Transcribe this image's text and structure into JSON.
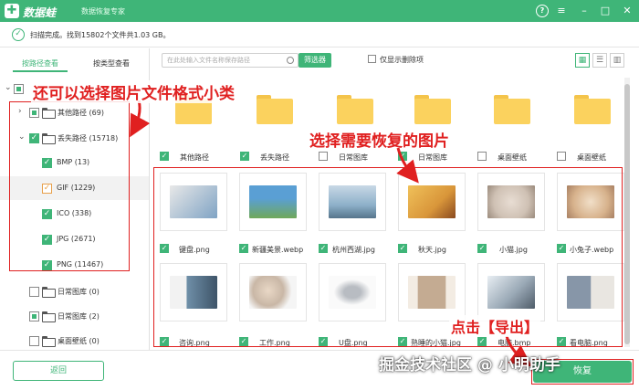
{
  "app": {
    "name": "数据蛙",
    "subtitle": "数据恢复专家"
  },
  "status": {
    "text": "扫描完成。找到15802个文件共1.03 GB。"
  },
  "left_tabs": [
    "按路径查看",
    "按类型查看"
  ],
  "tree": [
    {
      "label": "其他路径 (69)"
    },
    {
      "label": "丢失路径 (15718)"
    },
    {
      "label": "BMP (13)"
    },
    {
      "label": "GIF (1229)"
    },
    {
      "label": "ICO (338)"
    },
    {
      "label": "JPG (2671)"
    },
    {
      "label": "PNG (11467)"
    },
    {
      "label": "日常图库 (0)"
    },
    {
      "label": "日常图库 (2)"
    },
    {
      "label": "桌面壁纸 (0)"
    }
  ],
  "toolbar": {
    "search_placeholder": "在此处输入文件名称保存路径",
    "filter_label": "筛选器",
    "only_deleted_label": "仅显示删除项"
  },
  "folders": [
    "其他路径",
    "丢失路径",
    "日常图库",
    "日常图库",
    "桌面壁纸",
    "桌面壁纸"
  ],
  "images": [
    {
      "name": "键盘.png",
      "color": "#7fa3c4"
    },
    {
      "name": "新疆美景.webp",
      "color": "#5a9fd4"
    },
    {
      "name": "杭州西湖.jpg",
      "color": "#8db0c9"
    },
    {
      "name": "秋天.jpg",
      "color": "#d9963a"
    },
    {
      "name": "小猫.jpg",
      "color": "#cfc1b4"
    },
    {
      "name": "小兔子.webp",
      "color": "#d7b28c"
    },
    {
      "name": "咨询.png",
      "color": "#6f8fa8"
    },
    {
      "name": "工作.png",
      "color": "#c9b7a6"
    },
    {
      "name": "U盘.png",
      "color": "#b8bcc2"
    },
    {
      "name": "熟睡的小猫.jpg",
      "color": "#c4ab92"
    },
    {
      "name": "电脑.bmp",
      "color": "#9aa9b6"
    },
    {
      "name": "看电脑.png",
      "color": "#8796a8"
    }
  ],
  "buttons": {
    "back": "返回",
    "export": "恢复"
  },
  "annotations": {
    "left": "还可以选择图片文件格式小类",
    "right": "选择需要恢复的图片",
    "bottom": "点击【导出】"
  },
  "watermark": "掘金技术社区 @ 小明助手"
}
